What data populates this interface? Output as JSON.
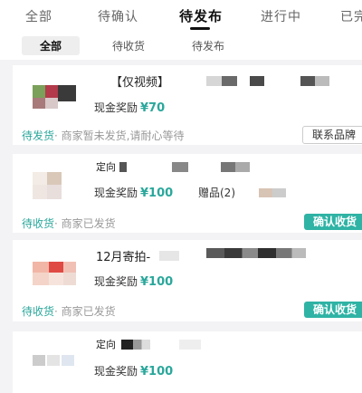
{
  "tabs": [
    {
      "label": "全部"
    },
    {
      "label": "待确认"
    },
    {
      "label": "待发布",
      "active": true
    },
    {
      "label": "进行中"
    },
    {
      "label": "已完"
    }
  ],
  "subtabs": [
    {
      "label": "全部",
      "active": true
    },
    {
      "label": "待收货"
    },
    {
      "label": "待发布"
    }
  ],
  "orders": [
    {
      "title": "【仅视频】",
      "reward_label": "现金奖励",
      "reward_amount": "¥70",
      "status": "待发货",
      "status_note": "· 商家暂未发货,请耐心等待",
      "button": "联系品牌"
    },
    {
      "title": "定向",
      "reward_label": "现金奖励",
      "reward_amount": "¥100",
      "gift": "赠品(2)",
      "status": "待收货",
      "status_note": "· 商家已发货",
      "button": "确认收货"
    },
    {
      "title": "12月寄拍-",
      "reward_label": "现金奖励",
      "reward_amount": "¥100",
      "status": "待收货",
      "status_note": "· 商家已发货",
      "button": "确认收货"
    },
    {
      "title": "定向",
      "reward_label": "现金奖励",
      "reward_amount": "¥100"
    }
  ],
  "colors": {
    "accent": "#2aa79b",
    "button": "#2fb3a5",
    "background": "#f3f3f5"
  }
}
